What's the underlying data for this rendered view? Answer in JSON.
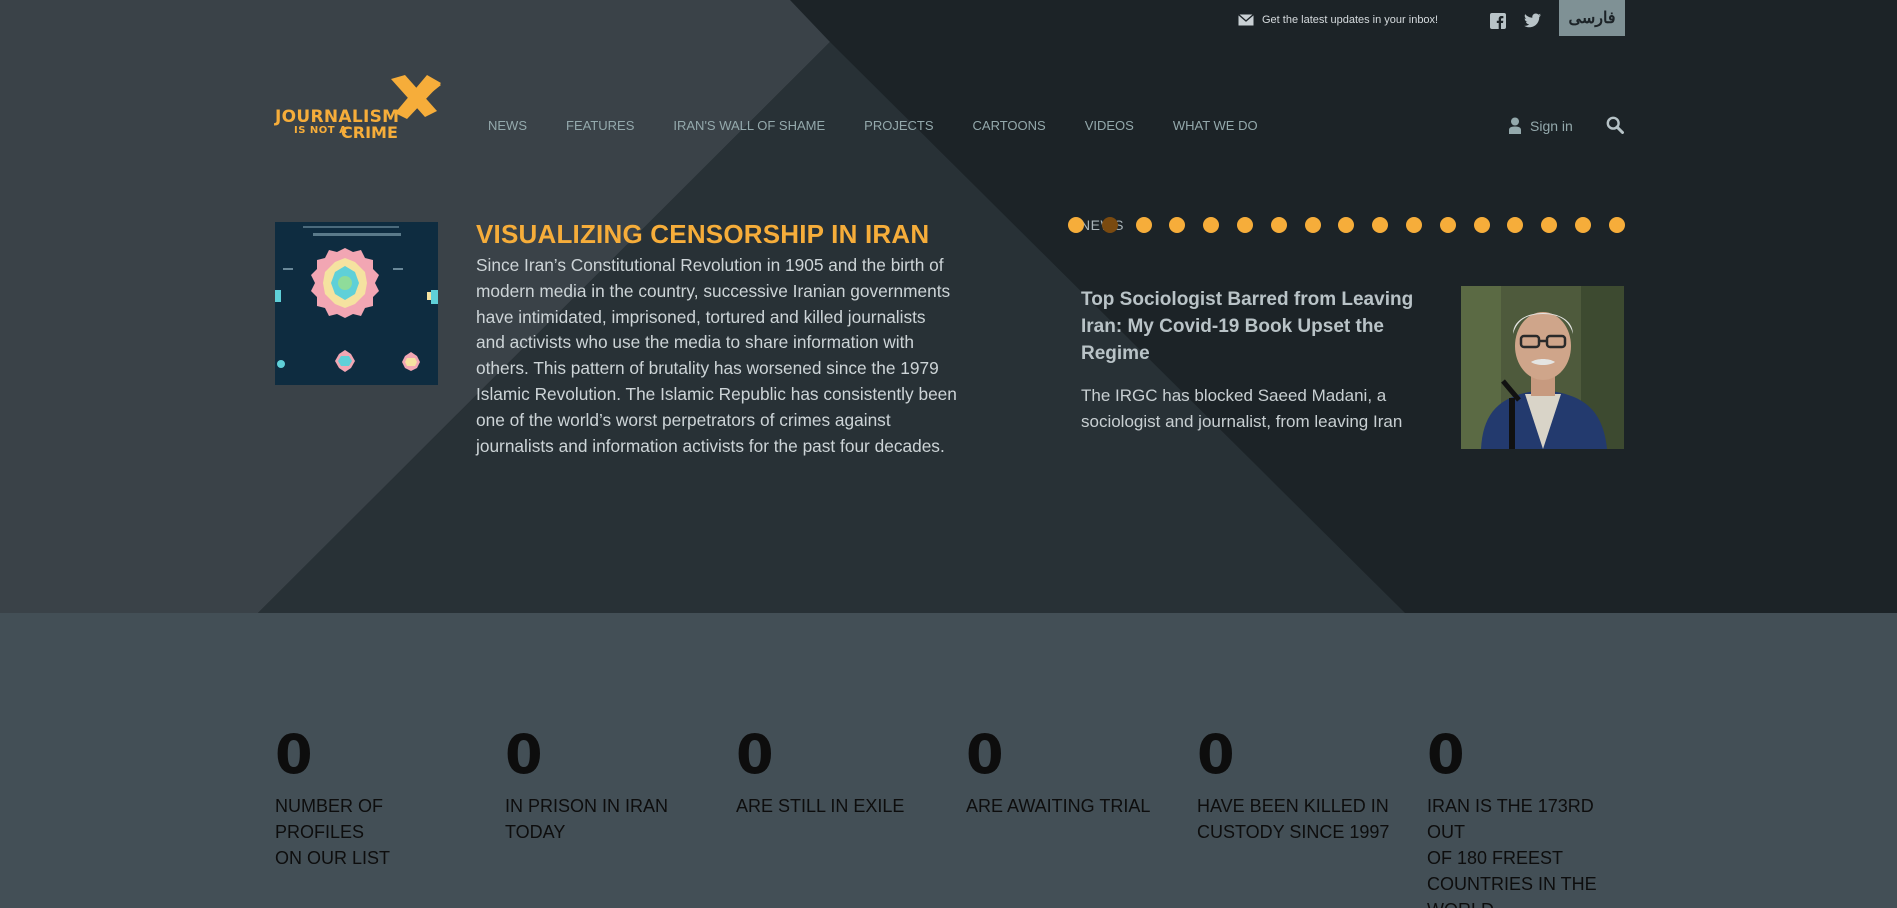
{
  "topbar": {
    "newsletter_text": "Get the latest updates in your inbox!",
    "language_button": "فارسی",
    "social": [
      "facebook-icon",
      "twitter-icon"
    ]
  },
  "logo": {
    "line1": "JOURNALISM",
    "line2": "IS NOT A",
    "line3": "CRIME",
    "color": "#f6ad3a"
  },
  "nav": {
    "items": [
      "NEWS",
      "FEATURES",
      "IRAN'S WALL OF SHAME",
      "PROJECTS",
      "CARTOONS",
      "VIDEOS",
      "WHAT WE DO"
    ],
    "sign_in": "Sign in"
  },
  "feature": {
    "title": "VISUALIZING CENSORSHIP IN IRAN",
    "body_lines": [
      "Since Iran’s Constitutional Revolution in 1905 and the birth of",
      "modern media in the country, successive Iranian governments",
      "have intimidated, imprisoned, tortured and killed journalists",
      "and activists who use the media to share information with",
      "others. This pattern of brutality has worsened since the 1979",
      "Islamic Revolution. The Islamic Republic has consistently been",
      "one of the world’s worst perpetrators of crimes against",
      "journalists and information activists for the past four decades."
    ]
  },
  "slider": {
    "label": "NEWS",
    "dot_count": 17,
    "active_dot": 1,
    "title_lines": [
      "Top Sociologist Barred from Leaving",
      "Iran: My Covid-19 Book Upset the",
      "Regime"
    ],
    "desc_lines": [
      "The IRGC has blocked Saeed Madani, a",
      "sociologist and journalist, from leaving Iran"
    ]
  },
  "stats": [
    {
      "value": "0",
      "label_lines": [
        "NUMBER OF PROFILES",
        "ON OUR LIST"
      ]
    },
    {
      "value": "0",
      "label_lines": [
        "IN PRISON IN IRAN",
        "TODAY"
      ]
    },
    {
      "value": "0",
      "label_lines": [
        "ARE STILL IN EXILE"
      ]
    },
    {
      "value": "0",
      "label_lines": [
        "ARE AWAITING TRIAL"
      ]
    },
    {
      "value": "0",
      "label_lines": [
        "HAVE BEEN KILLED IN",
        "CUSTODY SINCE 1997"
      ]
    },
    {
      "value": "0",
      "label_lines": [
        "IRAN IS THE 173RD OUT",
        "OF 180 FREEST",
        "COUNTRIES IN THE",
        "WORLD"
      ]
    }
  ],
  "colors": {
    "accent": "#f6ad3a",
    "hero_dark": "#1c2327",
    "hero_light": "#3a4248",
    "stats_bg": "#434f56",
    "nav_text": "#94a9ac"
  }
}
